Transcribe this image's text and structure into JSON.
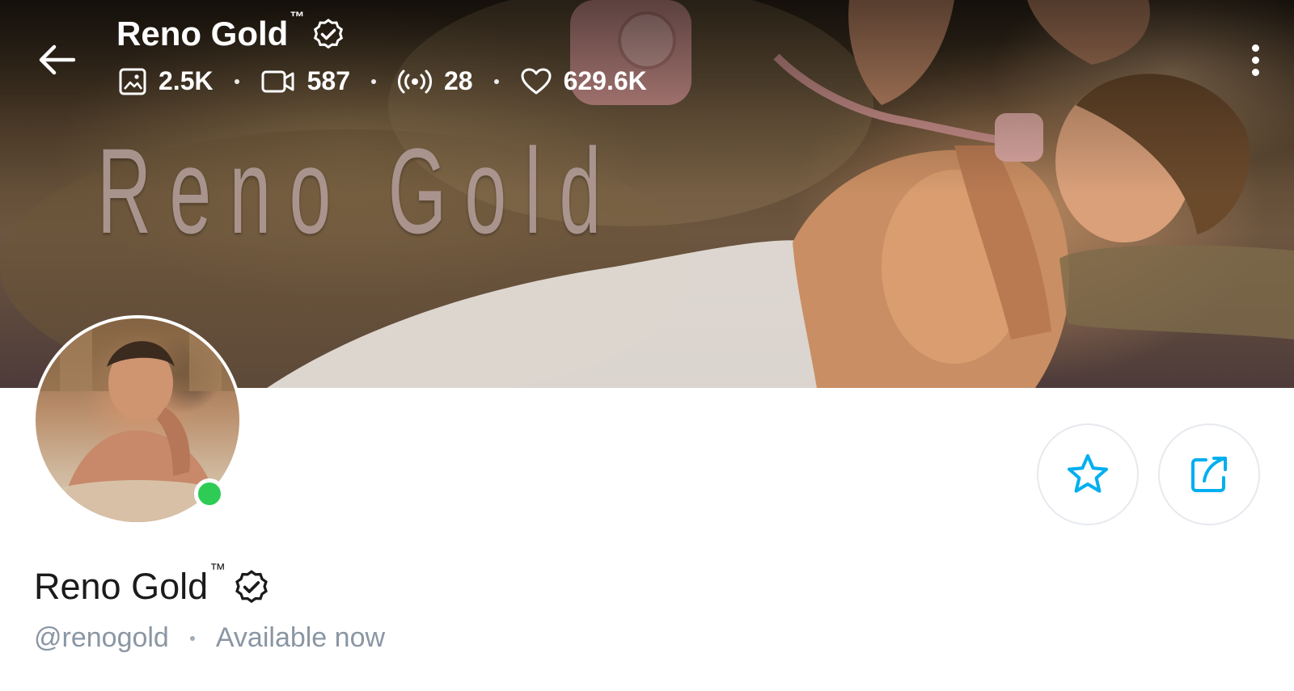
{
  "header": {
    "name": "Reno Gold",
    "trademark": "™",
    "stats": [
      {
        "icon": "image-icon",
        "value": "2.5K"
      },
      {
        "icon": "video-icon",
        "value": "587"
      },
      {
        "icon": "live-stream-icon",
        "value": "28"
      },
      {
        "icon": "heart-icon",
        "value": "629.6K"
      }
    ]
  },
  "cover": {
    "watermark_text": "Reno Gold"
  },
  "profile": {
    "name": "Reno Gold",
    "trademark": "™",
    "username": "@renogold",
    "status": "Available now",
    "online": true
  },
  "colors": {
    "accent": "#00aff0",
    "online": "#2ecc55",
    "muted_text": "#8a96a3"
  }
}
